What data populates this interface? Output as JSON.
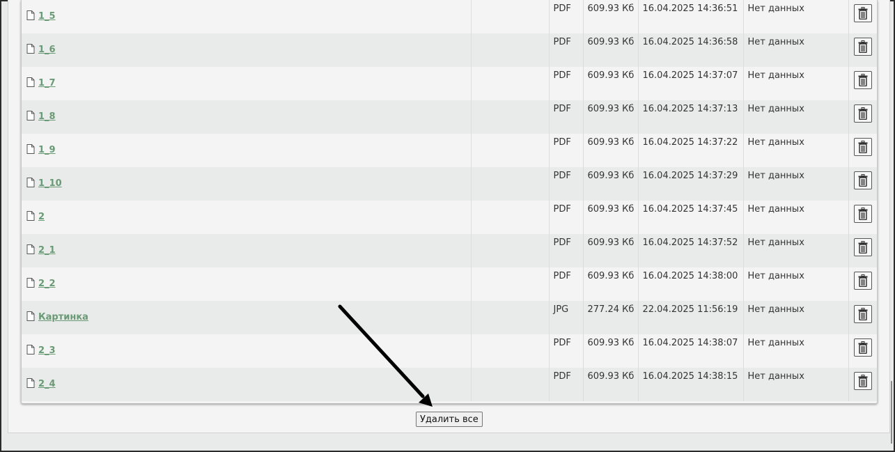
{
  "files": [
    {
      "name": "1_5",
      "type": "PDF",
      "size": "609.93 Кб",
      "date": "16.04.2025 14:36:51",
      "status": "Нет данных"
    },
    {
      "name": "1_6",
      "type": "PDF",
      "size": "609.93 Кб",
      "date": "16.04.2025 14:36:58",
      "status": "Нет данных"
    },
    {
      "name": "1_7",
      "type": "PDF",
      "size": "609.93 Кб",
      "date": "16.04.2025 14:37:07",
      "status": "Нет данных"
    },
    {
      "name": "1_8",
      "type": "PDF",
      "size": "609.93 Кб",
      "date": "16.04.2025 14:37:13",
      "status": "Нет данных"
    },
    {
      "name": "1_9",
      "type": "PDF",
      "size": "609.93 Кб",
      "date": "16.04.2025 14:37:22",
      "status": "Нет данных"
    },
    {
      "name": "1_10",
      "type": "PDF",
      "size": "609.93 Кб",
      "date": "16.04.2025 14:37:29",
      "status": "Нет данных"
    },
    {
      "name": "2",
      "type": "PDF",
      "size": "609.93 Кб",
      "date": "16.04.2025 14:37:45",
      "status": "Нет данных"
    },
    {
      "name": "2_1",
      "type": "PDF",
      "size": "609.93 Кб",
      "date": "16.04.2025 14:37:52",
      "status": "Нет данных"
    },
    {
      "name": "2_2",
      "type": "PDF",
      "size": "609.93 Кб",
      "date": "16.04.2025 14:38:00",
      "status": "Нет данных"
    },
    {
      "name": "Картинка",
      "type": "JPG",
      "size": "277.24 Кб",
      "date": "22.04.2025 11:56:19",
      "status": "Нет данных"
    },
    {
      "name": "2_3",
      "type": "PDF",
      "size": "609.93 Кб",
      "date": "16.04.2025 14:38:07",
      "status": "Нет данных"
    },
    {
      "name": "2_4",
      "type": "PDF",
      "size": "609.93 Кб",
      "date": "16.04.2025 14:38:15",
      "status": "Нет данных"
    }
  ],
  "row_icons": {
    "file": "file-icon",
    "delete": "trash-icon"
  },
  "delete_all_label": "Удалить все",
  "annotation": {
    "icon": "arrow-icon",
    "color": "#000000"
  },
  "colors": {
    "link": "#6a9a75",
    "row_alt": "#e9ebea",
    "row": "#f4f4f4"
  }
}
